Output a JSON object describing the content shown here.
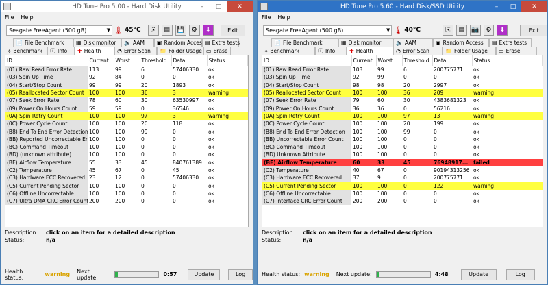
{
  "windows": [
    {
      "title": "HD Tune Pro 5.00 - Hard Disk Utility",
      "menu": [
        "File",
        "Help"
      ],
      "drive": "Seagate FreeAgent          (500 gB)",
      "temperature": "45°C",
      "exit_label": "Exit",
      "tabs_row1": [
        {
          "label": "File Benchmark",
          "icon": "file-icon"
        },
        {
          "label": "Disk monitor",
          "icon": "monitor-icon"
        },
        {
          "label": "AAM",
          "icon": "speaker-icon"
        },
        {
          "label": "Random Access",
          "icon": "random-icon"
        },
        {
          "label": "Extra tests",
          "icon": "tests-icon"
        }
      ],
      "tabs_row2": [
        {
          "label": "Benchmark",
          "icon": "benchmark-icon"
        },
        {
          "label": "Info",
          "icon": "info-icon"
        },
        {
          "label": "Health",
          "icon": "health-icon"
        },
        {
          "label": "Error Scan",
          "icon": "errorscan-icon"
        },
        {
          "label": "Folder Usage",
          "icon": "folder-icon"
        },
        {
          "label": "Erase",
          "icon": "erase-icon"
        }
      ],
      "columns": [
        "ID",
        "Current",
        "Worst",
        "Threshold",
        "Data",
        "Status"
      ],
      "rows": [
        {
          "id": "(01) Raw Read Error Rate",
          "current": "113",
          "worst": "99",
          "threshold": "6",
          "data": "57406330",
          "status": "ok",
          "state": ""
        },
        {
          "id": "(03) Spin Up Time",
          "current": "92",
          "worst": "84",
          "threshold": "0",
          "data": "0",
          "status": "ok",
          "state": ""
        },
        {
          "id": "(04) Start/Stop Count",
          "current": "99",
          "worst": "99",
          "threshold": "20",
          "data": "1893",
          "status": "ok",
          "state": ""
        },
        {
          "id": "(05) Reallocated Sector Count",
          "current": "100",
          "worst": "100",
          "threshold": "36",
          "data": "3",
          "status": "warning",
          "state": "warn"
        },
        {
          "id": "(07) Seek Error Rate",
          "current": "78",
          "worst": "60",
          "threshold": "30",
          "data": "63530997",
          "status": "ok",
          "state": ""
        },
        {
          "id": "(09) Power On Hours Count",
          "current": "59",
          "worst": "59",
          "threshold": "0",
          "data": "36546",
          "status": "ok",
          "state": ""
        },
        {
          "id": "(0A) Spin Retry Count",
          "current": "100",
          "worst": "100",
          "threshold": "97",
          "data": "3",
          "status": "warning",
          "state": "warn"
        },
        {
          "id": "(0C) Power Cycle Count",
          "current": "100",
          "worst": "100",
          "threshold": "20",
          "data": "118",
          "status": "ok",
          "state": ""
        },
        {
          "id": "(B8) End To End Error Detection",
          "current": "100",
          "worst": "100",
          "threshold": "99",
          "data": "0",
          "status": "ok",
          "state": ""
        },
        {
          "id": "(BB) Reported Uncorrectable Errors",
          "current": "100",
          "worst": "100",
          "threshold": "0",
          "data": "0",
          "status": "ok",
          "state": ""
        },
        {
          "id": "(BC) Command Timeout",
          "current": "100",
          "worst": "100",
          "threshold": "0",
          "data": "0",
          "status": "ok",
          "state": ""
        },
        {
          "id": "(BD) (unknown attribute)",
          "current": "100",
          "worst": "100",
          "threshold": "0",
          "data": "0",
          "status": "ok",
          "state": ""
        },
        {
          "id": "(BE) Airflow Temperature",
          "current": "55",
          "worst": "33",
          "threshold": "45",
          "data": "840761389",
          "status": "ok",
          "state": ""
        },
        {
          "id": "(C2) Temperature",
          "current": "45",
          "worst": "67",
          "threshold": "0",
          "data": "45",
          "status": "ok",
          "state": ""
        },
        {
          "id": "(C3) Hardware ECC Recovered",
          "current": "23",
          "worst": "12",
          "threshold": "0",
          "data": "57406330",
          "status": "ok",
          "state": ""
        },
        {
          "id": "(C5) Current Pending Sector",
          "current": "100",
          "worst": "100",
          "threshold": "0",
          "data": "0",
          "status": "ok",
          "state": ""
        },
        {
          "id": "(C6) Offline Uncorrectable",
          "current": "100",
          "worst": "100",
          "threshold": "0",
          "data": "0",
          "status": "ok",
          "state": ""
        },
        {
          "id": "(C7) Ultra DMA CRC Error Count",
          "current": "200",
          "worst": "200",
          "threshold": "0",
          "data": "0",
          "status": "ok",
          "state": ""
        }
      ],
      "description_label": "Description:",
      "description_value": "click on an item for a detailed description",
      "status_label": "Status:",
      "status_value": "n/a",
      "health_label": "Health status:",
      "health_value": "warning",
      "next_update_label": "Next update:",
      "next_update_time": "0:57",
      "progress": 0.07,
      "update_label": "Update",
      "log_label": "Log"
    },
    {
      "title": "HD Tune Pro 5.60 - Hard Disk/SSD Utility",
      "menu": [
        "File",
        "Help"
      ],
      "drive": "Seagate FreeAgent (500 gB)",
      "temperature": "40°C",
      "exit_label": "Exit",
      "tabs_row1": [
        {
          "label": "File Benchmark",
          "icon": "file-icon"
        },
        {
          "label": "Disk monitor",
          "icon": "monitor-icon"
        },
        {
          "label": "AAM",
          "icon": "speaker-icon"
        },
        {
          "label": "Random Access",
          "icon": "random-icon"
        },
        {
          "label": "Extra tests",
          "icon": "tests-icon"
        }
      ],
      "tabs_row2": [
        {
          "label": "Benchmark",
          "icon": "benchmark-icon"
        },
        {
          "label": "Info",
          "icon": "info-icon"
        },
        {
          "label": "Health",
          "icon": "health-icon"
        },
        {
          "label": "Error Scan",
          "icon": "errorscan-icon"
        },
        {
          "label": "Folder Usage",
          "icon": "folder-icon"
        },
        {
          "label": "Erase",
          "icon": "erase-icon"
        }
      ],
      "columns": [
        "ID",
        "Current",
        "Worst",
        "Threshold",
        "Data",
        "Status"
      ],
      "rows": [
        {
          "id": "(01) Raw Read Error Rate",
          "current": "103",
          "worst": "99",
          "threshold": "6",
          "data": "200775771",
          "status": "ok",
          "state": ""
        },
        {
          "id": "(03) Spin Up Time",
          "current": "92",
          "worst": "99",
          "threshold": "0",
          "data": "0",
          "status": "ok",
          "state": ""
        },
        {
          "id": "(04) Start/Stop Count",
          "current": "98",
          "worst": "98",
          "threshold": "20",
          "data": "2997",
          "status": "ok",
          "state": ""
        },
        {
          "id": "(05) Reallocated Sector Count",
          "current": "100",
          "worst": "100",
          "threshold": "36",
          "data": "209",
          "status": "warning",
          "state": "warn"
        },
        {
          "id": "(07) Seek Error Rate",
          "current": "79",
          "worst": "60",
          "threshold": "30",
          "data": "4383681323",
          "status": "ok",
          "state": ""
        },
        {
          "id": "(09) Power On Hours Count",
          "current": "36",
          "worst": "36",
          "threshold": "0",
          "data": "56216",
          "status": "ok",
          "state": ""
        },
        {
          "id": "(0A) Spin Retry Count",
          "current": "100",
          "worst": "100",
          "threshold": "97",
          "data": "13",
          "status": "warning",
          "state": "warn"
        },
        {
          "id": "(0C) Power Cycle Count",
          "current": "100",
          "worst": "100",
          "threshold": "20",
          "data": "199",
          "status": "ok",
          "state": ""
        },
        {
          "id": "(B8) End To End Error Detection",
          "current": "100",
          "worst": "100",
          "threshold": "99",
          "data": "0",
          "status": "ok",
          "state": ""
        },
        {
          "id": "(BB) Uncorrectable Error Count",
          "current": "100",
          "worst": "100",
          "threshold": "0",
          "data": "0",
          "status": "ok",
          "state": ""
        },
        {
          "id": "(BC) Command Timeout",
          "current": "100",
          "worst": "100",
          "threshold": "0",
          "data": "0",
          "status": "ok",
          "state": ""
        },
        {
          "id": "(BD) Unknown Attribute",
          "current": "100",
          "worst": "100",
          "threshold": "0",
          "data": "0",
          "status": "ok",
          "state": ""
        },
        {
          "id": "(BE) Airflow Temperature",
          "current": "60",
          "worst": "33",
          "threshold": "45",
          "data": "76948917...",
          "status": "failed",
          "state": "fail"
        },
        {
          "id": "(C2) Temperature",
          "current": "40",
          "worst": "67",
          "threshold": "0",
          "data": "90194313256",
          "status": "ok",
          "state": ""
        },
        {
          "id": "(C3) Hardware ECC Recovered",
          "current": "37",
          "worst": "9",
          "threshold": "0",
          "data": "200775771",
          "status": "ok",
          "state": ""
        },
        {
          "id": "(C5) Current Pending Sector",
          "current": "100",
          "worst": "100",
          "threshold": "0",
          "data": "122",
          "status": "warning",
          "state": "warn"
        },
        {
          "id": "(C6) Offline Uncorrectable",
          "current": "100",
          "worst": "100",
          "threshold": "0",
          "data": "0",
          "status": "ok",
          "state": ""
        },
        {
          "id": "(C7) Interface CRC Error Count",
          "current": "200",
          "worst": "200",
          "threshold": "0",
          "data": "0",
          "status": "ok",
          "state": ""
        }
      ],
      "description_label": "Description:",
      "description_value": "click on an item for a detailed description",
      "status_label": "Status:",
      "status_value": "n/a",
      "health_label": "Health status:",
      "health_value": "warning",
      "next_update_label": "Next update:",
      "next_update_time": "4:48",
      "progress": 0.05,
      "update_label": "Update",
      "log_label": "Log"
    }
  ],
  "colors": {
    "warning_row": "#ffff40",
    "failed_row": "#ff4040",
    "warning_text": "#d9a300",
    "progress_fill": "#2fb24c",
    "active_titlebar": "#2f73c6"
  }
}
